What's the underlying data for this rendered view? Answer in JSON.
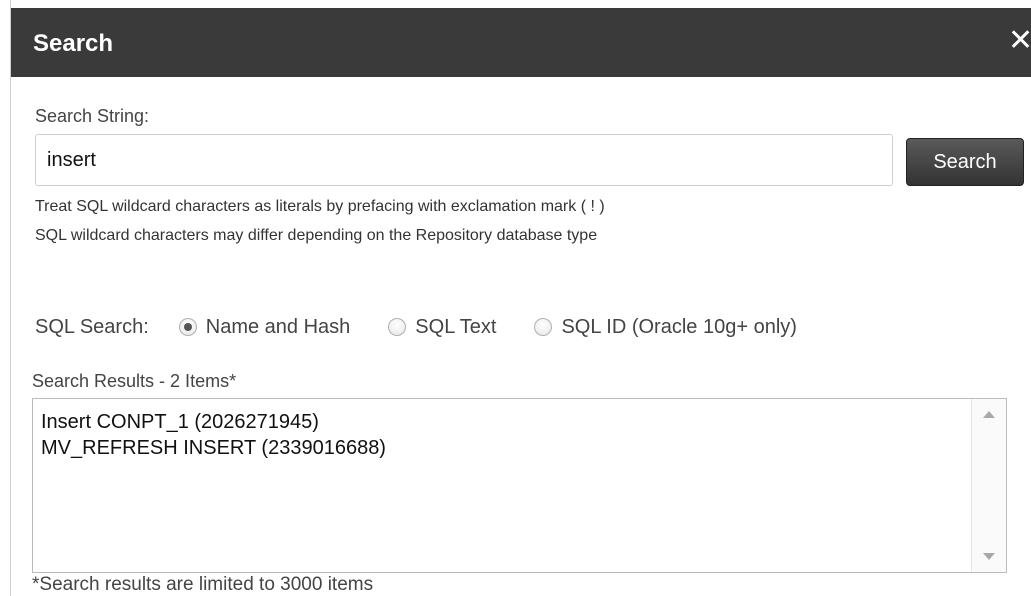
{
  "dialog": {
    "title": "Search",
    "close_glyph": "✕",
    "close_icon": "close-icon"
  },
  "search": {
    "label": "Search String:",
    "value": "insert",
    "button_label": "Search"
  },
  "hints": {
    "line1": "Treat SQL wildcard characters as literals by prefacing with exclamation mark ( ! )",
    "line2": "SQL wildcard characters may differ depending on the Repository database type"
  },
  "sql_search": {
    "label": "SQL Search:",
    "options": [
      {
        "label": "Name and Hash",
        "selected": true
      },
      {
        "label": "SQL Text",
        "selected": false
      },
      {
        "label": "SQL ID (Oracle 10g+ only)",
        "selected": false
      }
    ]
  },
  "results": {
    "label": "Search Results - 2 Items*",
    "items": [
      "Insert CONPT_1 (2026271945)",
      "MV_REFRESH INSERT (2339016688)"
    ],
    "footnote": "*Search results are limited to 3000 items"
  },
  "colors": {
    "titlebar": "#3a3a3a",
    "button": "#444444"
  }
}
